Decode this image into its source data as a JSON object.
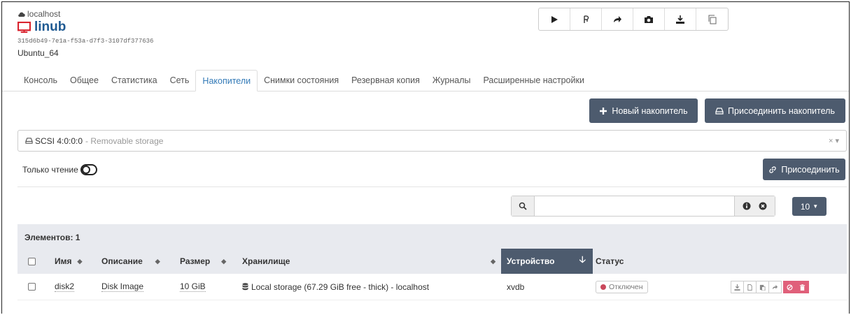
{
  "header": {
    "host": "localhost",
    "vm_name": "linub",
    "uuid": "315d6b49-7e1a-f53a-d7f3-3107df377636",
    "os": "Ubuntu_64"
  },
  "toolbar": [
    "play-icon",
    "pause-icon",
    "redo-icon",
    "camera-icon",
    "download-icon",
    "copy-icon"
  ],
  "tabs": [
    {
      "label": "Консоль"
    },
    {
      "label": "Общее"
    },
    {
      "label": "Статистика"
    },
    {
      "label": "Сеть"
    },
    {
      "label": "Накопители",
      "active": true
    },
    {
      "label": "Снимки состояния"
    },
    {
      "label": "Резервная копия"
    },
    {
      "label": "Журналы"
    },
    {
      "label": "Расширенные настройки"
    }
  ],
  "buttons": {
    "new_disk": "Новый накопитель",
    "attach_disk": "Присоединить накопитель",
    "attach": "Присоединить"
  },
  "storage_select": {
    "value": "SCSI 4:0:0:0",
    "hint": "- Removable storage",
    "controls": "× ▾"
  },
  "readonly_label": "Только чтение",
  "readonly_value": false,
  "search": {
    "placeholder": ""
  },
  "pager": {
    "value": "10"
  },
  "table": {
    "count": "Элементов: 1",
    "columns": [
      "Имя",
      "Описание",
      "Размер",
      "Хранилище",
      "Устройство",
      "Статус"
    ],
    "rows": [
      {
        "name": "disk2",
        "description": "Disk Image",
        "size": "10 GiB",
        "storage": "Local storage (67.29 GiB free - thick) - localhost",
        "device": "xvdb",
        "status": "Отключен"
      }
    ]
  },
  "colors": {
    "accent": "#4d5b6e",
    "link": "#337ab7",
    "danger": "#e0607a"
  }
}
